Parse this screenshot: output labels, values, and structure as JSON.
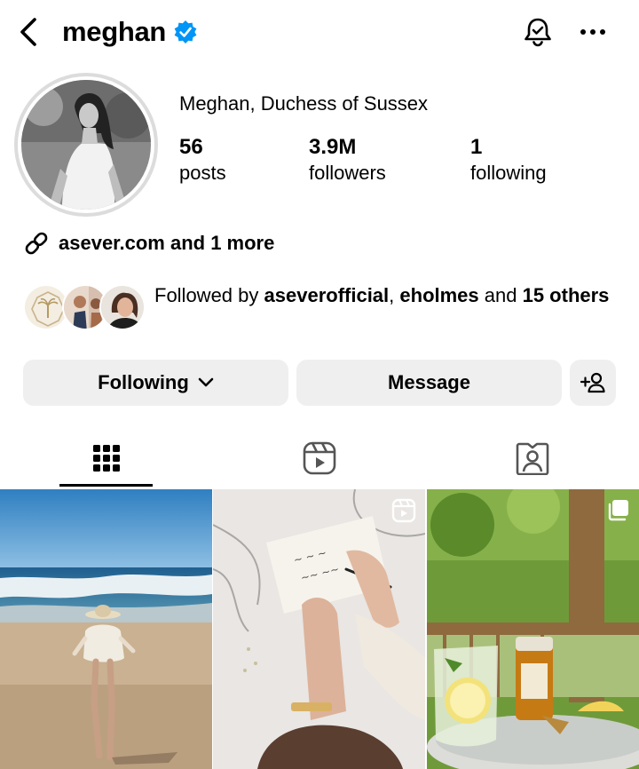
{
  "header": {
    "username": "meghan",
    "icons": {
      "back": "chevron-left-icon",
      "verified": "verified-badge-icon",
      "notifications": "bell-check-icon",
      "more": "more-horizontal-icon"
    }
  },
  "profile": {
    "full_name": "Meghan, Duchess of Sussex",
    "stats": [
      {
        "value": "56",
        "label": "posts"
      },
      {
        "value": "3.9M",
        "label": "followers"
      },
      {
        "value": "1",
        "label": "following"
      }
    ],
    "link": "asever.com and 1 more",
    "followed_by": {
      "prefix": "Followed by ",
      "name1": "aseverofficial",
      "sep": ", ",
      "name2": "eholmes",
      "and": " and ",
      "others": "15 others"
    }
  },
  "actions": {
    "following_label": "Following",
    "message_label": "Message"
  },
  "tabs": [
    "posts-grid",
    "reels",
    "tagged"
  ],
  "colors": {
    "verified": "#0095f6",
    "button_bg": "#efefef",
    "divider": "#dcdcdc"
  }
}
